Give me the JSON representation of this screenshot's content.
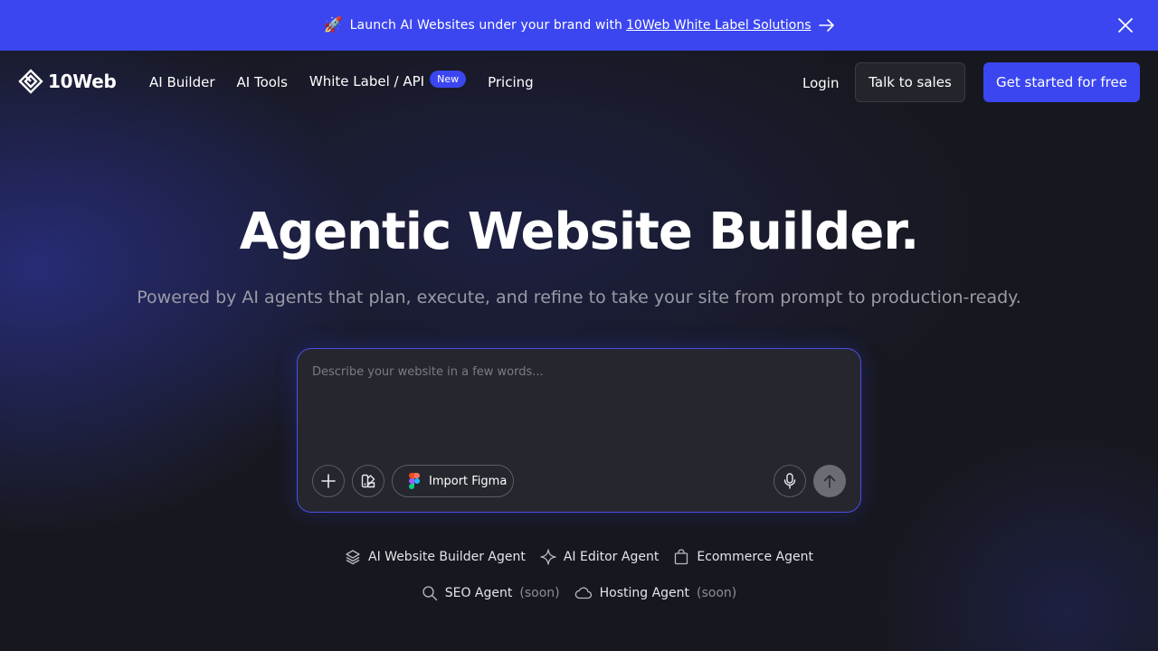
{
  "announcement": {
    "rocket": "🚀",
    "text": "Launch AI Websites under your brand with",
    "link": "10Web White Label Solutions"
  },
  "header": {
    "logo_text": "10Web",
    "nav": [
      {
        "label": "AI Builder"
      },
      {
        "label": "AI Tools"
      },
      {
        "label": "White Label / API",
        "badge": "New"
      },
      {
        "label": "Pricing"
      }
    ],
    "login": "Login",
    "talk_to_sales": "Talk to sales",
    "get_started": "Get started for free"
  },
  "hero": {
    "title": "Agentic Website Builder.",
    "subtitle": "Powered by AI agents that plan, execute, and refine to take your site from prompt to production-ready."
  },
  "prompt": {
    "placeholder": "Describe your website in a few words...",
    "import_figma": "Import Figma"
  },
  "agents": {
    "row1": [
      {
        "label": "AI Website Builder Agent",
        "icon": "layers-icon"
      },
      {
        "label": "AI Editor Agent",
        "icon": "sparkle-icon"
      },
      {
        "label": "Ecommerce Agent",
        "icon": "shopping-bag-icon"
      }
    ],
    "row2": [
      {
        "label": "SEO Agent",
        "soon": "(soon)",
        "icon": "search-icon"
      },
      {
        "label": "Hosting Agent",
        "soon": "(soon)",
        "icon": "cloud-icon"
      }
    ]
  },
  "colors": {
    "accent": "#3b46f0",
    "background": "#17181f"
  }
}
